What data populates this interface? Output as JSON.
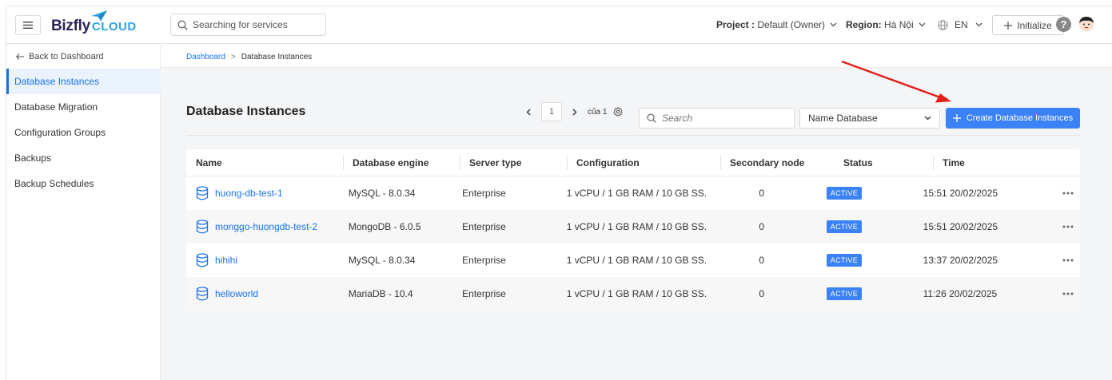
{
  "header": {
    "logo_main": "Bizfly",
    "logo_sub": "CLOUD",
    "search_placeholder": "Searching for services",
    "project_label": "Project :",
    "project_value": "Default (Owner)",
    "region_label": "Region:",
    "region_value": "Hà Nội",
    "language": "EN",
    "initialize_label": "Initialize",
    "help_label": "?"
  },
  "sidebar": {
    "back_label": "Back to Dashboard",
    "items": [
      {
        "label": "Database Instances",
        "active": true
      },
      {
        "label": "Database Migration",
        "active": false
      },
      {
        "label": "Configuration Groups",
        "active": false
      },
      {
        "label": "Backups",
        "active": false
      },
      {
        "label": "Backup Schedules",
        "active": false
      }
    ]
  },
  "breadcrumb": {
    "root": "Dashboard",
    "separator": ">",
    "current": "Database Instances"
  },
  "main": {
    "title": "Database Instances",
    "pager": {
      "page": "1",
      "of_label": "của 1"
    },
    "search_placeholder": "Search",
    "filter_select": "Name Database",
    "create_label": "Create Database Instances"
  },
  "table": {
    "columns": [
      "Name",
      "Database engine",
      "Server type",
      "Configuration",
      "Secondary node",
      "Status",
      "Time"
    ],
    "rows": [
      {
        "name": "huong-db-test-1",
        "engine": "MySQL - 8.0.34",
        "server": "Enterprise",
        "config": "1 vCPU / 1 GB RAM / 10 GB SS...",
        "secondary": "0",
        "status": "ACTIVE",
        "time": "15:51 20/02/2025"
      },
      {
        "name": "monggo-huongdb-test-2",
        "engine": "MongoDB - 6.0.5",
        "server": "Enterprise",
        "config": "1 vCPU / 1 GB RAM / 10 GB SS...",
        "secondary": "0",
        "status": "ACTIVE",
        "time": "15:51 20/02/2025"
      },
      {
        "name": "hihihi",
        "engine": "MySQL - 8.0.34",
        "server": "Enterprise",
        "config": "1 vCPU / 1 GB RAM / 10 GB SS...",
        "secondary": "0",
        "status": "ACTIVE",
        "time": "13:37 20/02/2025"
      },
      {
        "name": "helloworld",
        "engine": "MariaDB - 10.4",
        "server": "Enterprise",
        "config": "1 vCPU / 1 GB RAM / 10 GB SS...",
        "secondary": "0",
        "status": "ACTIVE",
        "time": "11:26 20/02/2025"
      }
    ]
  },
  "colors": {
    "accent": "#3b82f6",
    "link": "#1a73e8",
    "annotation_arrow": "#e0201b",
    "logo_dark": "#2a2558",
    "logo_light": "#2aa3e0"
  }
}
